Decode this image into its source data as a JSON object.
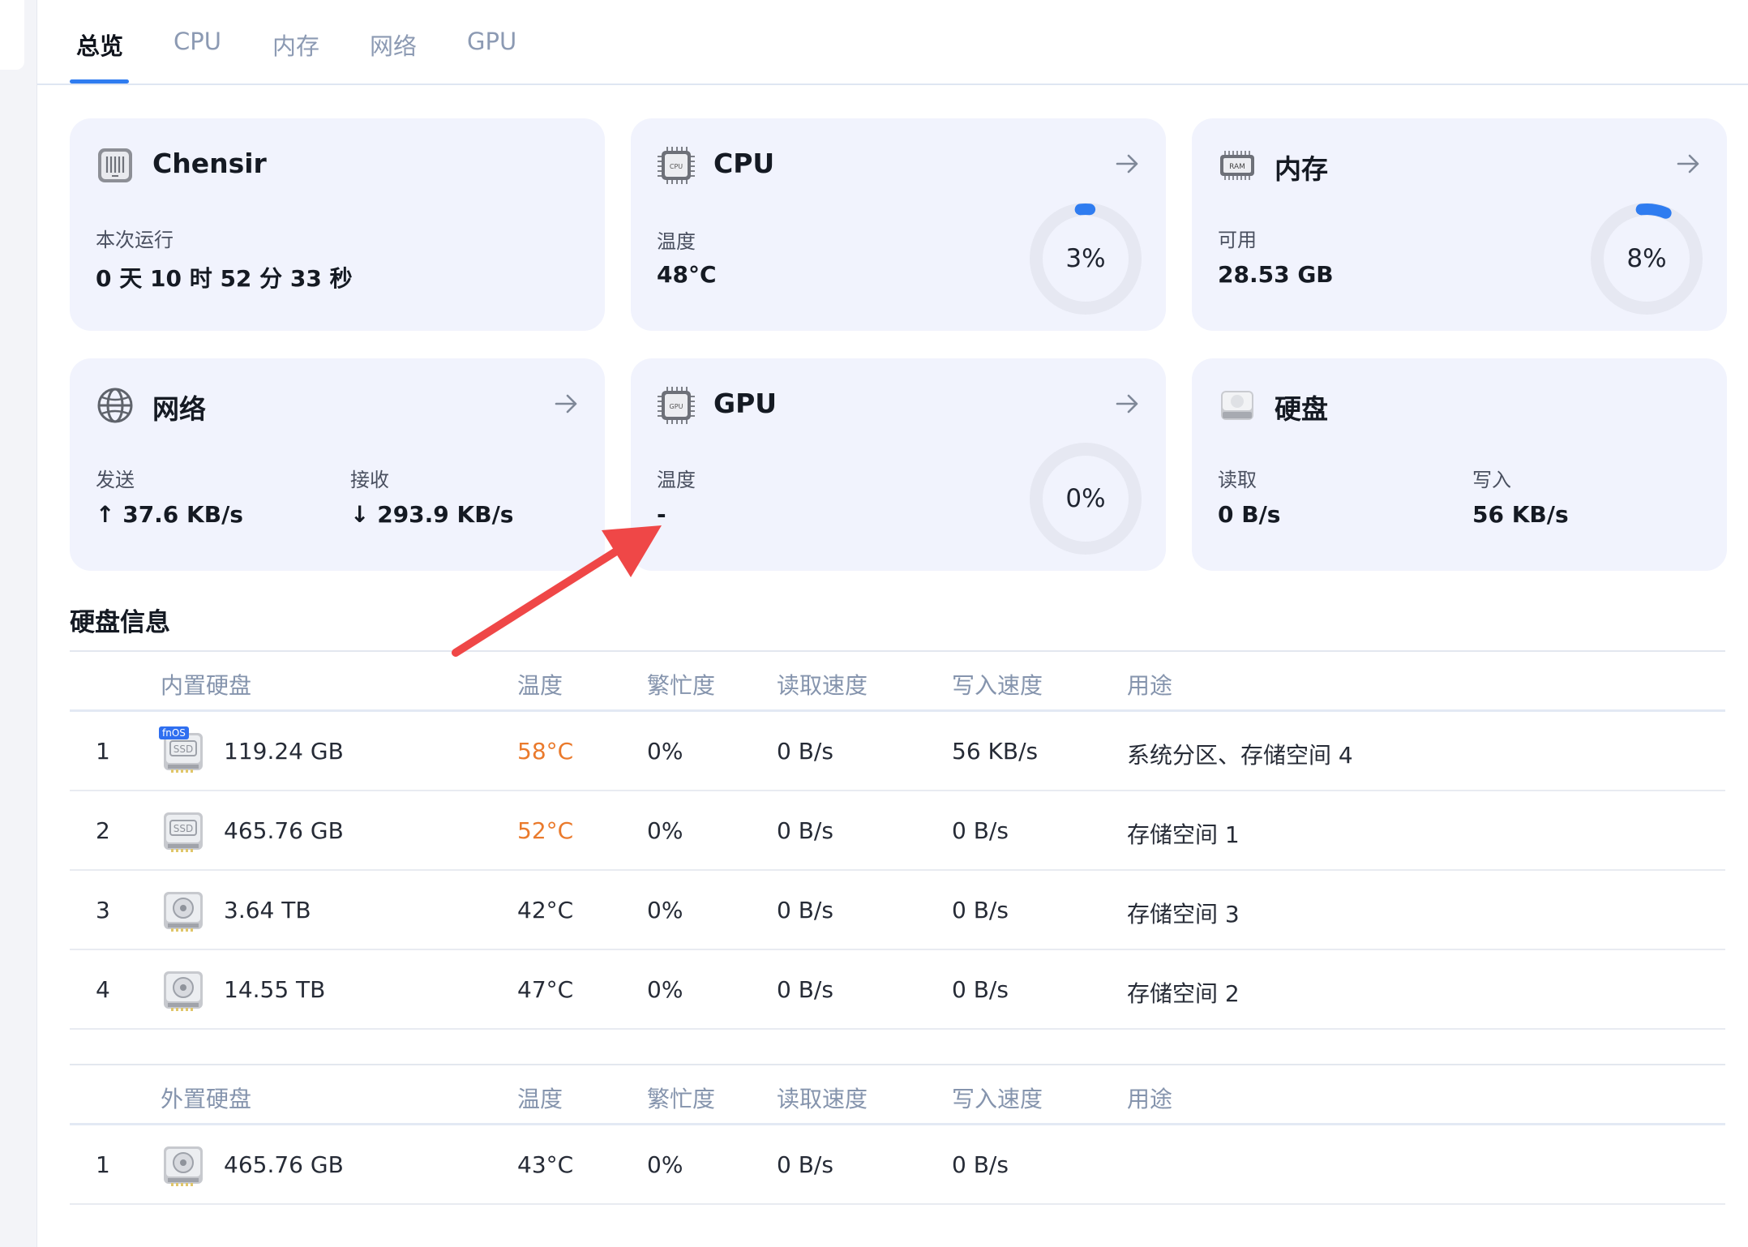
{
  "tabs": [
    {
      "label": "总览",
      "active": true
    },
    {
      "label": "CPU",
      "active": false
    },
    {
      "label": "内存",
      "active": false
    },
    {
      "label": "网络",
      "active": false
    },
    {
      "label": "GPU",
      "active": false
    }
  ],
  "cards": {
    "host": {
      "title": "Chensir",
      "uptime_label": "本次运行",
      "uptime_value": "0 天 10 时 52 分 33 秒"
    },
    "cpu": {
      "title": "CPU",
      "icon_text": "CPU",
      "temp_label": "温度",
      "temp_value": "48°C",
      "usage_text": "3%",
      "usage": 0.03
    },
    "memory": {
      "title": "内存",
      "icon_text": "RAM",
      "avail_label": "可用",
      "avail_value": "28.53 GB",
      "usage_text": "8%",
      "usage": 0.08
    },
    "network": {
      "title": "网络",
      "send_label": "发送",
      "send_value": "↑ 37.6 KB/s",
      "recv_label": "接收",
      "recv_value": "↓ 293.9 KB/s"
    },
    "gpu": {
      "title": "GPU",
      "icon_text": "GPU",
      "temp_label": "温度",
      "temp_value": "-",
      "usage_text": "0%",
      "usage": 0
    },
    "disk": {
      "title": "硬盘",
      "read_label": "读取",
      "read_value": "0 B/s",
      "write_label": "写入",
      "write_value": "56 KB/s"
    }
  },
  "disk_info": {
    "title": "硬盘信息",
    "internal": {
      "headers": [
        "内置硬盘",
        "温度",
        "繁忙度",
        "读取速度",
        "写入速度",
        "用途"
      ],
      "rows": [
        {
          "idx": "1",
          "type": "ssd-fnos",
          "tag": "fnOS",
          "icon_text": "SSD",
          "size": "119.24 GB",
          "temp": "58°C",
          "hot": true,
          "busy": "0%",
          "read": "0 B/s",
          "write": "56 KB/s",
          "use": "系统分区、存储空间 4"
        },
        {
          "idx": "2",
          "type": "ssd",
          "icon_text": "SSD",
          "size": "465.76 GB",
          "temp": "52°C",
          "hot": true,
          "busy": "0%",
          "read": "0 B/s",
          "write": "0 B/s",
          "use": "存储空间 1"
        },
        {
          "idx": "3",
          "type": "hdd",
          "size": "3.64 TB",
          "temp": "42°C",
          "hot": false,
          "busy": "0%",
          "read": "0 B/s",
          "write": "0 B/s",
          "use": "存储空间 3"
        },
        {
          "idx": "4",
          "type": "hdd",
          "size": "14.55 TB",
          "temp": "47°C",
          "hot": false,
          "busy": "0%",
          "read": "0 B/s",
          "write": "0 B/s",
          "use": "存储空间 2"
        }
      ]
    },
    "external": {
      "headers": [
        "外置硬盘",
        "温度",
        "繁忙度",
        "读取速度",
        "写入速度",
        "用途"
      ],
      "rows": [
        {
          "idx": "1",
          "type": "hdd",
          "size": "465.76 GB",
          "temp": "43°C",
          "hot": false,
          "busy": "0%",
          "read": "0 B/s",
          "write": "0 B/s",
          "use": ""
        }
      ]
    }
  },
  "colors": {
    "accent": "#2f7cf0",
    "card_bg": "#f1f3fd",
    "hot_temp": "#ea7a2c",
    "annotation_arrow": "#ef4747"
  }
}
